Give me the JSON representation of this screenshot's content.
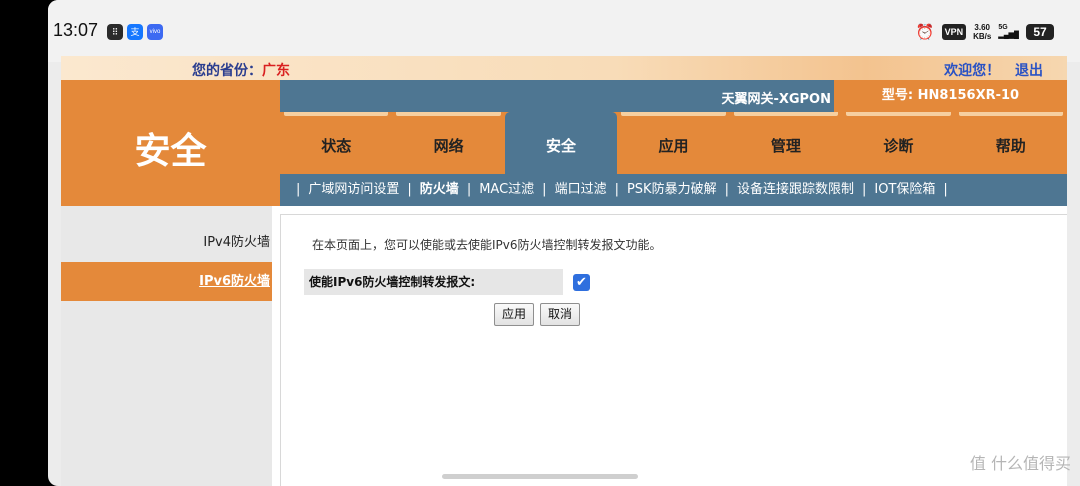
{
  "status_bar": {
    "time": "13:07",
    "vpn": "VPN",
    "speed_value": "3.60",
    "speed_unit": "KB/s",
    "net_type": "5G",
    "battery": "57"
  },
  "top_bar": {
    "province_label": "您的省份：",
    "province_value": "广东",
    "welcome": "欢迎您！",
    "logout": "退出"
  },
  "header": {
    "section_title": "安全",
    "gateway_name": "天翼网关-XGPON",
    "model": "型号: HN8156XR-10"
  },
  "nav": {
    "tabs": [
      {
        "label": "状态"
      },
      {
        "label": "网络"
      },
      {
        "label": "安全"
      },
      {
        "label": "应用"
      },
      {
        "label": "管理"
      },
      {
        "label": "诊断"
      },
      {
        "label": "帮助"
      }
    ],
    "active_index": 2
  },
  "subnav": {
    "items": [
      {
        "label": "广域网访问设置"
      },
      {
        "label": "防火墙"
      },
      {
        "label": "MAC过滤"
      },
      {
        "label": "端口过滤"
      },
      {
        "label": "PSK防暴力破解"
      },
      {
        "label": "设备连接跟踪数限制"
      },
      {
        "label": "IOT保险箱"
      }
    ],
    "separator": "|",
    "active_index": 1
  },
  "sidebar": {
    "items": [
      {
        "label": "IPv4防火墙"
      },
      {
        "label": "IPv6防火墙"
      }
    ],
    "active_index": 1
  },
  "content": {
    "description": "在本页面上，您可以使能或去使能IPv6防火墙控制转发报文功能。",
    "enable_label": "使能IPv6防火墙控制转发报文:",
    "enable_checked": true,
    "apply_button": "应用",
    "cancel_button": "取消"
  },
  "watermark": "值 什么值得买",
  "colors": {
    "orange": "#e4893a",
    "steel_blue": "#4e7692",
    "checkbox_blue": "#2f6fde",
    "province_red": "#d92020"
  }
}
